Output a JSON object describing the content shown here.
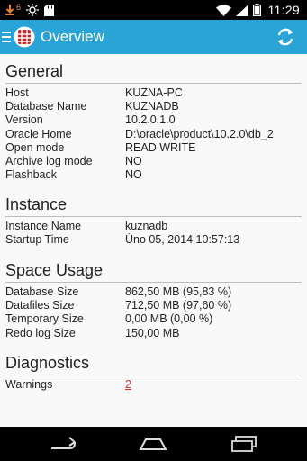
{
  "status_bar": {
    "notification_count": "6",
    "time": "11:29",
    "icons": [
      "download-notification-icon",
      "brightness-icon",
      "sd-card-icon",
      "wifi-icon",
      "signal-icon",
      "battery-icon"
    ]
  },
  "action_bar": {
    "title": "Overview",
    "logo_icon": "database-app-icon",
    "refresh_icon": "refresh-icon",
    "color": "#2aa3d6"
  },
  "sections": {
    "general": {
      "title": "General",
      "rows": [
        {
          "key": "Host",
          "value": "KUZNA-PC"
        },
        {
          "key": "Database Name",
          "value": "KUZNADB"
        },
        {
          "key": "Version",
          "value": "10.2.0.1.0"
        },
        {
          "key": "Oracle Home",
          "value": "D:\\oracle\\product\\10.2.0\\db_2"
        },
        {
          "key": "Open mode",
          "value": "READ WRITE"
        },
        {
          "key": "Archive log mode",
          "value": "NO"
        },
        {
          "key": "Flashback",
          "value": "NO"
        }
      ]
    },
    "instance": {
      "title": "Instance",
      "rows": [
        {
          "key": "Instance Name",
          "value": "kuznadb"
        },
        {
          "key": "Startup Time",
          "value": "Úno 05, 2014 10:57:13"
        }
      ]
    },
    "space_usage": {
      "title": "Space Usage",
      "rows": [
        {
          "key": "Database Size",
          "value": "862,50 MB (95,83 %)"
        },
        {
          "key": "Datafiles Size",
          "value": "712,50 MB (97,60 %)"
        },
        {
          "key": "Temporary Size",
          "value": "0,00 MB (0,00 %)"
        },
        {
          "key": "Redo log Size",
          "value": "150,00 MB"
        }
      ]
    },
    "diagnostics": {
      "title": "Diagnostics",
      "rows": [
        {
          "key": "Warnings",
          "value": "2"
        }
      ]
    }
  },
  "nav_bar": {
    "back_icon": "back-icon",
    "home_icon": "home-icon",
    "recents_icon": "recent-apps-icon"
  }
}
